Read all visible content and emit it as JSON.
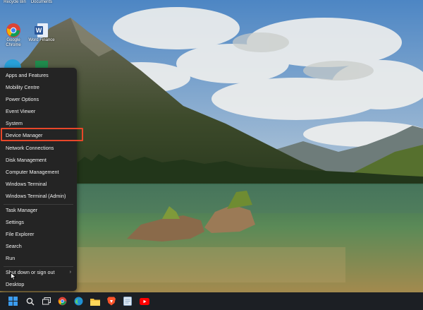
{
  "desktop": {
    "icons": [
      {
        "name": "recycle-bin-icon",
        "label": "Recycle Bin"
      },
      {
        "name": "documents-icon",
        "label": "Documents"
      },
      {
        "name": "chrome-icon",
        "label": "Google Chrome"
      },
      {
        "name": "word-icon",
        "label": "Word Finance"
      }
    ]
  },
  "context_menu": {
    "items": [
      "Apps and Features",
      "Mobility Centre",
      "Power Options",
      "Event Viewer",
      "System",
      "Device Manager",
      "Network Connections",
      "Disk Management",
      "Computer Management",
      "Windows Terminal",
      "Windows Terminal (Admin)",
      "Task Manager",
      "Settings",
      "File Explorer",
      "Search",
      "Run",
      "Shut down or sign out",
      "Desktop"
    ],
    "highlighted": "Device Manager",
    "submenu_arrow": "›"
  },
  "taskbar": {
    "icons": [
      "windows-start-icon",
      "search-icon",
      "task-view-icon",
      "chrome-icon",
      "edge-icon",
      "file-explorer-icon",
      "brave-icon",
      "notepad-icon",
      "youtube-icon"
    ]
  },
  "colors": {
    "menu_bg": "#242424",
    "highlight": "#e8472a",
    "taskbar_bg": "#1c1f24",
    "accent_blue": "#3b9cf0"
  }
}
